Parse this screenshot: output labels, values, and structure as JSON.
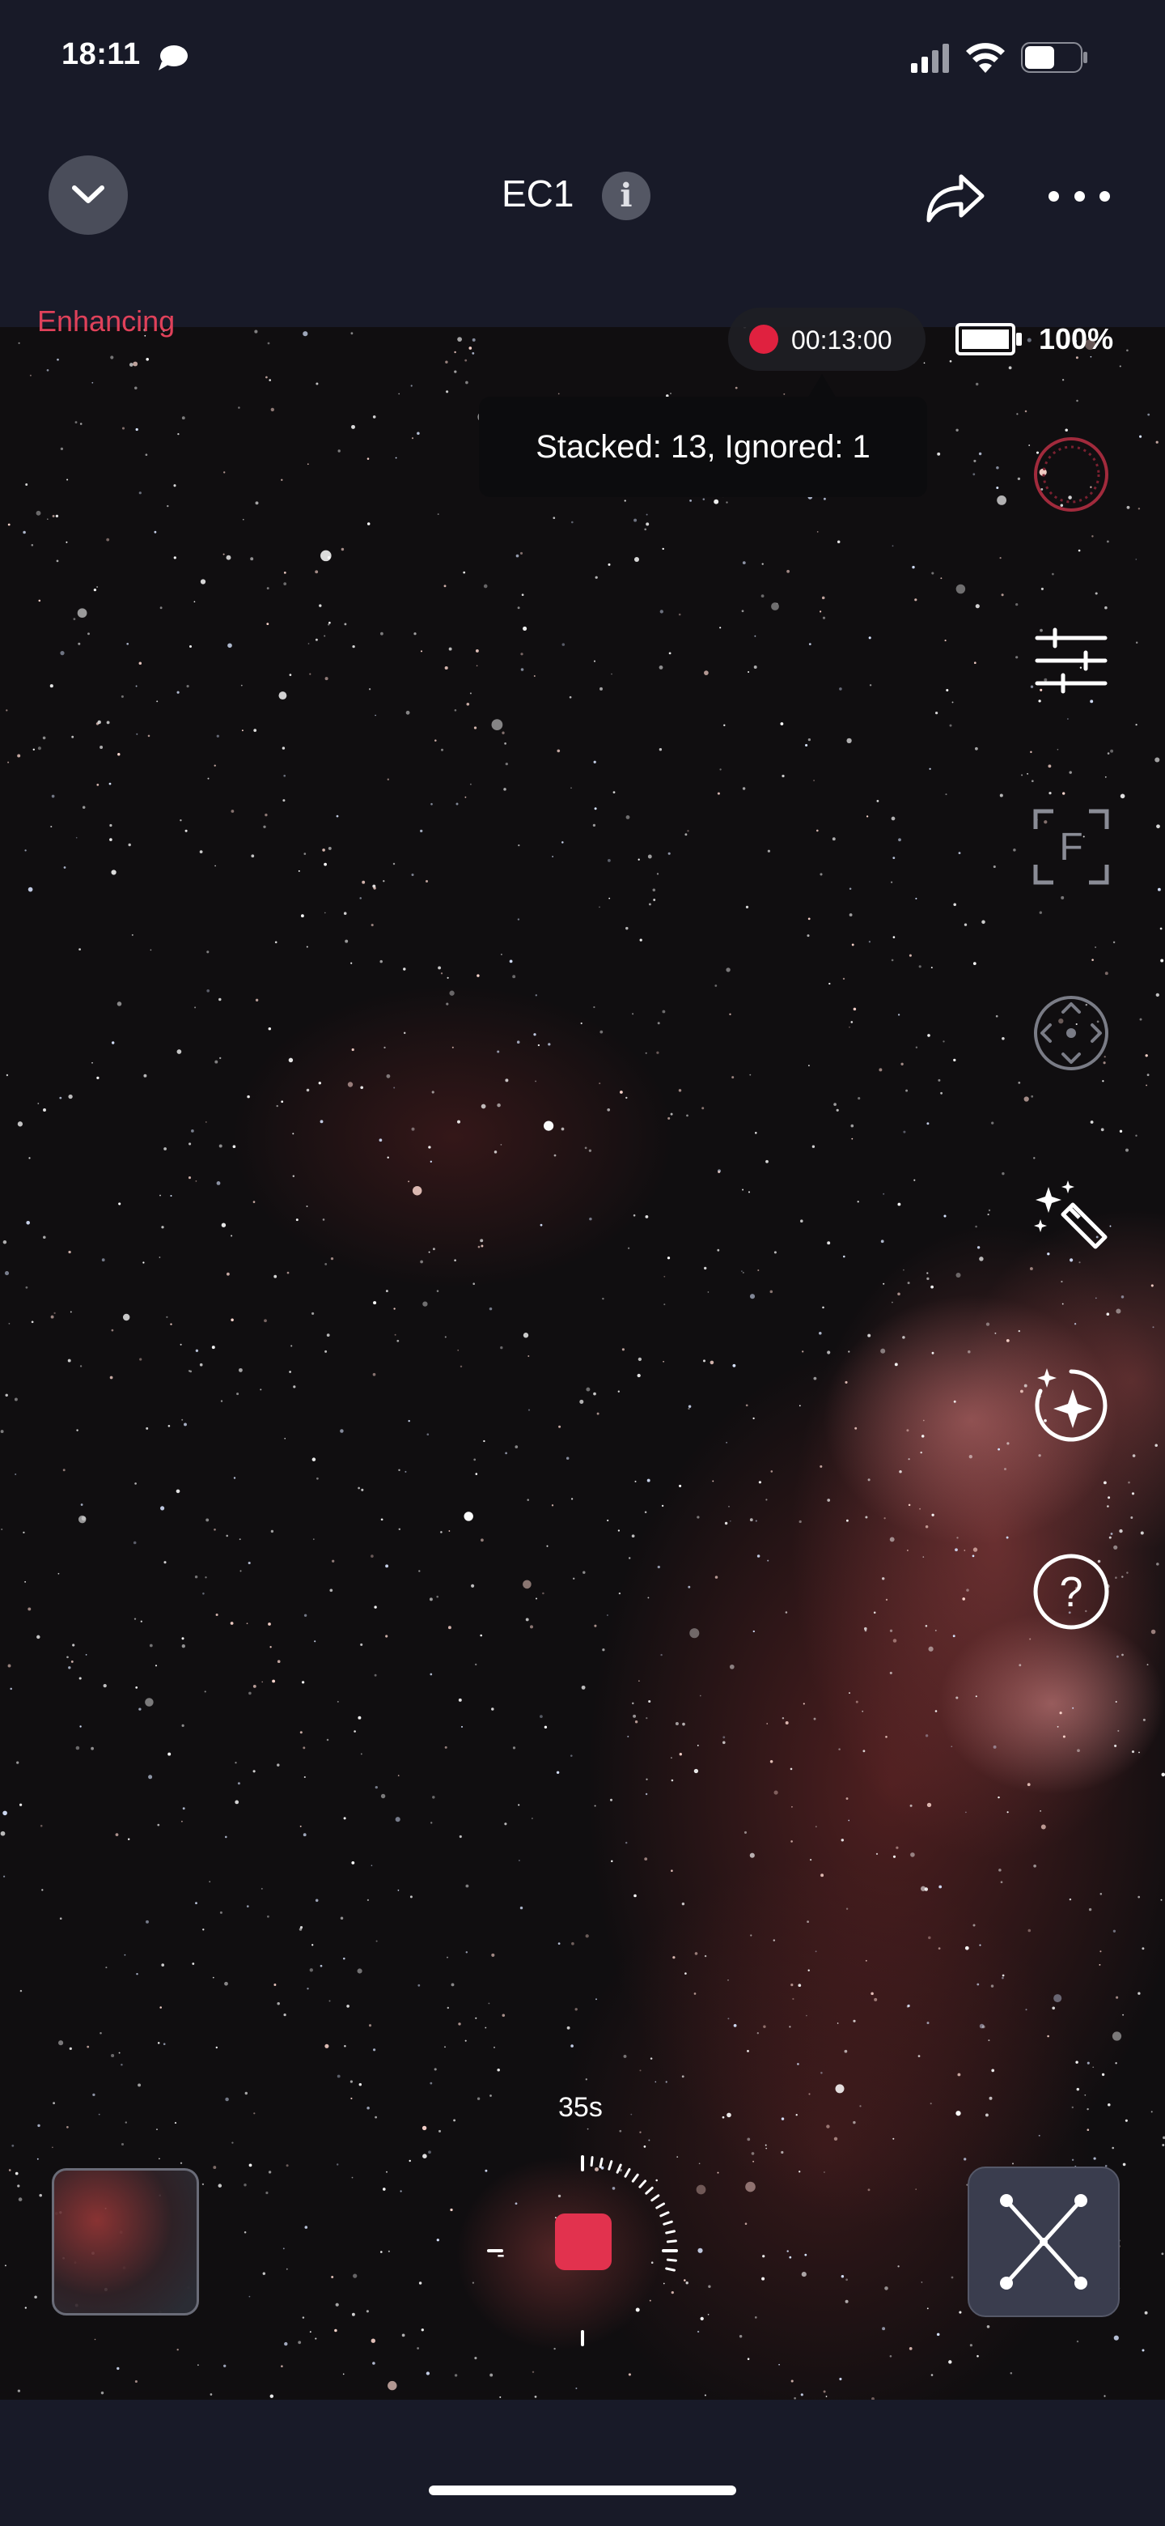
{
  "status_bar": {
    "time": "18:11",
    "icons": [
      "chat-bubble-icon",
      "signal-icon",
      "wifi-icon",
      "battery-icon"
    ]
  },
  "header": {
    "title": "EC1",
    "info_icon": "ℹ",
    "collapse_icon": "chevron-down-icon",
    "share_icon": "share-icon",
    "more_icon": "more-horizontal-icon"
  },
  "viewport": {
    "mode_label": "Enhancing",
    "recording": {
      "elapsed": "00:13:00",
      "indicator_color": "#e0213f"
    },
    "device_battery": {
      "level": 1.0,
      "label": "100%"
    },
    "tooltip": "Stacked: 13, Ignored: 1"
  },
  "toolbar": {
    "items": [
      {
        "name": "record-ring-icon",
        "interactable": true
      },
      {
        "name": "sliders-icon",
        "interactable": true
      },
      {
        "name": "focus-icon",
        "interactable": true
      },
      {
        "name": "move-pad-icon",
        "interactable": true
      },
      {
        "name": "magic-wand-icon",
        "interactable": true
      },
      {
        "name": "sparkle-icon",
        "interactable": true
      },
      {
        "name": "help-icon",
        "interactable": true
      }
    ],
    "focus_letter": "F",
    "help_glyph": "?"
  },
  "bottom": {
    "exposure": "35s",
    "dial_progress": 0.28,
    "minus_label": "-",
    "stop_color": "#e2324e"
  },
  "colors": {
    "accent": "#e0415a",
    "background": "#181a28"
  }
}
